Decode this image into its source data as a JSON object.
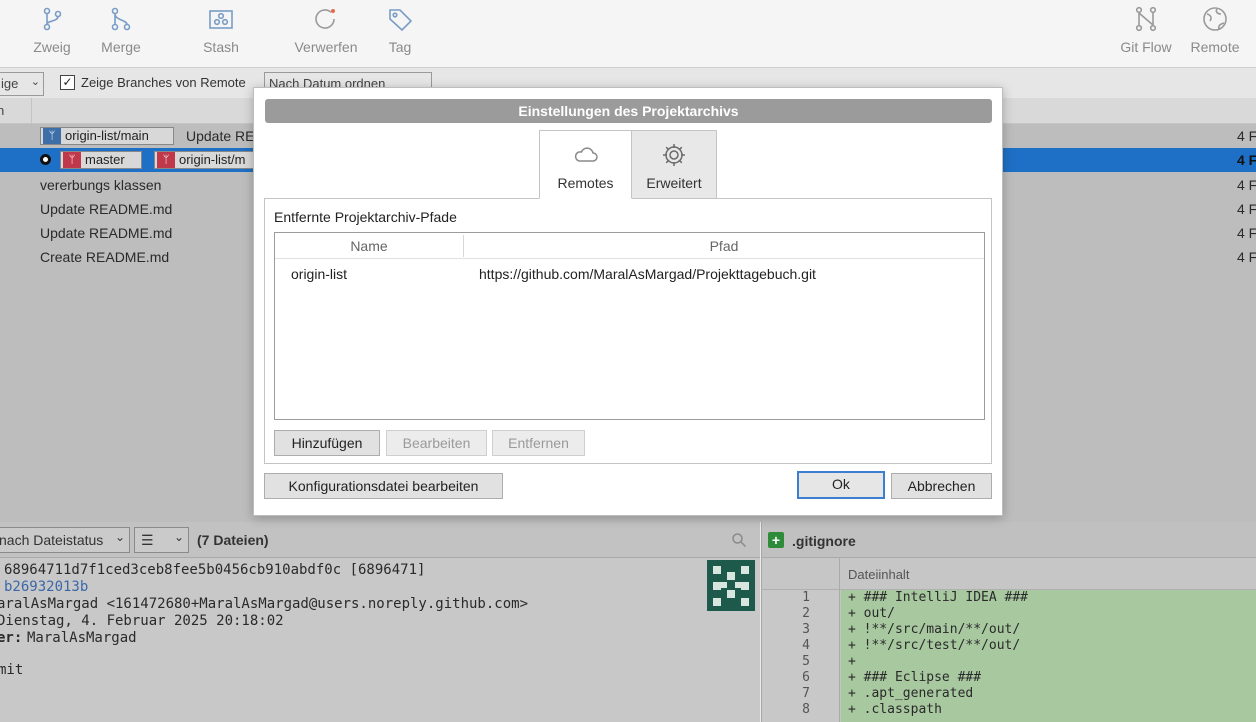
{
  "toolbar": {
    "left": [
      {
        "label": "Zweig",
        "icon": "branch-icon"
      },
      {
        "label": "Merge",
        "icon": "merge-icon"
      },
      {
        "label": "Stash",
        "icon": "stash-icon"
      },
      {
        "label": "Verwerfen",
        "icon": "discard-icon"
      },
      {
        "label": "Tag",
        "icon": "tag-icon"
      }
    ],
    "right": [
      {
        "label": "Git Flow",
        "icon": "git-flow-icon"
      },
      {
        "label": "Remote",
        "icon": "globe-icon"
      }
    ]
  },
  "filterbar": {
    "branches_select": "ige",
    "show_remote_checked": true,
    "show_remote_label": "Zeige Branches von Remote",
    "order_select": "Nach Datum ordnen"
  },
  "commits": {
    "head_label": "n",
    "rows": [
      {
        "message": "Update RE",
        "tags": [
          {
            "label": "origin-list/main",
            "color": "#3d6ea8"
          }
        ],
        "right": "4 F",
        "selected": false
      },
      {
        "message": "",
        "tags": [
          {
            "label": "master",
            "color": "#c0394b"
          },
          {
            "label": "origin-list/m",
            "color": "#c0394b"
          }
        ],
        "right": "4 F",
        "selected": true
      },
      {
        "message": "vererbungs klassen",
        "tags": [],
        "right": "4 F",
        "selected": false
      },
      {
        "message": "Update README.md",
        "tags": [],
        "right": "4 F",
        "selected": false
      },
      {
        "message": "Update README.md",
        "tags": [],
        "right": "4 F",
        "selected": false
      },
      {
        "message": "Create README.md",
        "tags": [],
        "right": "4 F",
        "selected": false
      }
    ]
  },
  "details_bar": {
    "sort_select": "nach Dateistatus",
    "view_select": "☰",
    "file_count": "(7 Dateien)"
  },
  "commit_details": {
    "hash_line": "68964711d7f1ced3ceb8fee5b0456cb910abdf0c [6896471]",
    "parent_line": "b26932013b",
    "author_line": "aralAsMargad <161472680+MaralAsMargad@users.noreply.github.com>",
    "date_line": "Dienstag, 4. Februar 2025 20:18:02",
    "committer_label": "er:",
    "committer_value": "MaralAsMargad",
    "message_line": "mit"
  },
  "diff": {
    "file_name": ".gitignore",
    "column_title": "Dateiinhalt",
    "lines": [
      {
        "n": "1",
        "text": "+ ### IntelliJ IDEA ###"
      },
      {
        "n": "2",
        "text": "+ out/"
      },
      {
        "n": "3",
        "text": "+ !**/src/main/**/out/"
      },
      {
        "n": "4",
        "text": "+ !**/src/test/**/out/"
      },
      {
        "n": "5",
        "text": "+"
      },
      {
        "n": "6",
        "text": "+ ### Eclipse ###"
      },
      {
        "n": "7",
        "text": "+ .apt_generated"
      },
      {
        "n": "8",
        "text": "+ .classpath"
      }
    ]
  },
  "dialog": {
    "title": "Einstellungen des Projektarchivs",
    "tabs": [
      {
        "label": "Remotes",
        "icon": "cloud-icon",
        "active": true
      },
      {
        "label": "Erweitert",
        "icon": "gear-icon",
        "active": false
      }
    ],
    "section_label": "Entfernte Projektarchiv-Pfade",
    "columns": {
      "name": "Name",
      "path": "Pfad"
    },
    "remotes": [
      {
        "name": "origin-list",
        "path": "https://github.com/MaralAsMargad/Projekttagebuch.git"
      }
    ],
    "buttons": {
      "add": "Hinzufügen",
      "edit": "Bearbeiten",
      "remove": "Entfernen",
      "edit_config": "Konfigurationsdatei bearbeiten",
      "ok": "Ok",
      "cancel": "Abbrechen"
    }
  }
}
